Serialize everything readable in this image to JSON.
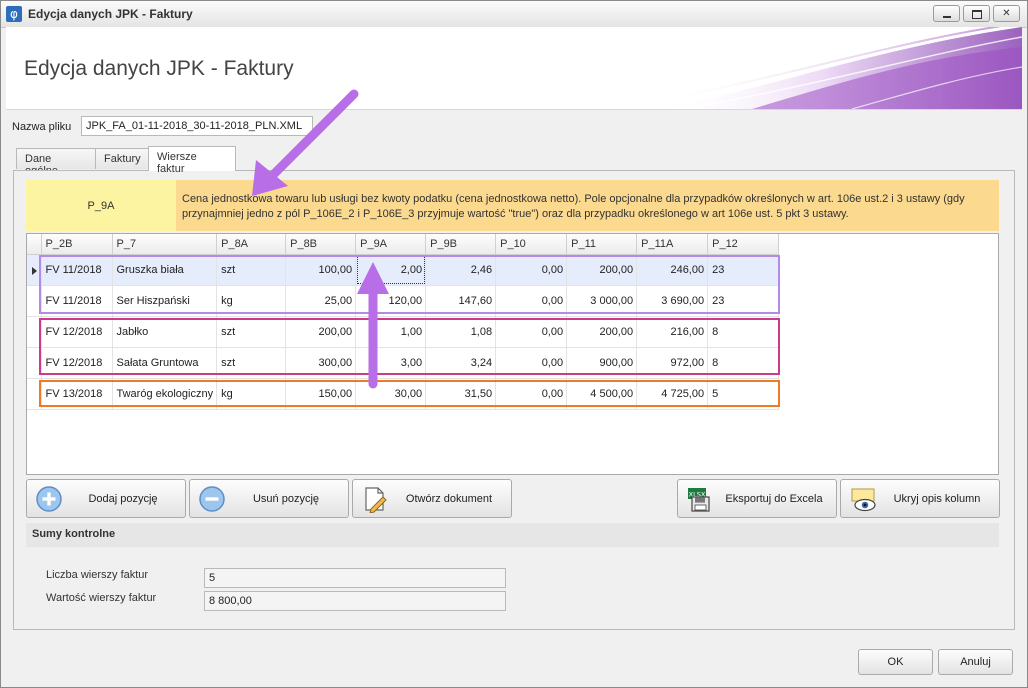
{
  "window": {
    "title": "Edycja danych JPK - Faktury"
  },
  "header": {
    "title": "Edycja danych JPK - Faktury"
  },
  "file": {
    "label": "Nazwa pliku",
    "value": "JPK_FA_01-11-2018_30-11-2018_PLN.XML"
  },
  "tabs": [
    "Dane ogólne",
    "Faktury",
    "Wiersze faktur"
  ],
  "description": {
    "key": "P_9A",
    "text": "Cena jednostkowa towaru lub usługi bez kwoty podatku (cena jednostkowa netto). Pole opcjonalne dla przypadków określonych w art. 106e ust.2 i 3 ustawy (gdy przynajmniej jedno z pól P_106E_2 i P_106E_3 przyjmuje wartość \"true\") oraz dla przypadku określonego w art 106e ust. 5 pkt 3 ustawy."
  },
  "grid": {
    "columns": [
      "P_2B",
      "P_7",
      "P_8A",
      "P_8B",
      "P_9A",
      "P_9B",
      "P_10",
      "P_11",
      "P_11A",
      "P_12"
    ],
    "rows": [
      [
        "FV 11/2018",
        "Gruszka biała",
        "szt",
        "100,00",
        "2,00",
        "2,46",
        "0,00",
        "200,00",
        "246,00",
        "23"
      ],
      [
        "FV 11/2018",
        "Ser Hiszpański",
        "kg",
        "25,00",
        "120,00",
        "147,60",
        "0,00",
        "3 000,00",
        "3 690,00",
        "23"
      ],
      [
        "FV 12/2018",
        "Jabłko",
        "szt",
        "200,00",
        "1,00",
        "1,08",
        "0,00",
        "200,00",
        "216,00",
        "8"
      ],
      [
        "FV 12/2018",
        "Sałata Gruntowa",
        "szt",
        "300,00",
        "3,00",
        "3,24",
        "0,00",
        "900,00",
        "972,00",
        "8"
      ],
      [
        "FV 13/2018",
        "Twaróg ekologiczny",
        "kg",
        "150,00",
        "30,00",
        "31,50",
        "0,00",
        "4 500,00",
        "4 725,00",
        "5"
      ]
    ]
  },
  "buttons": {
    "add": "Dodaj pozycję",
    "remove": "Usuń pozycję",
    "open": "Otwórz dokument",
    "export": "Eksportuj do Excela",
    "hide": "Ukryj opis kolumn"
  },
  "icons": {
    "add": "plus-circle-icon",
    "remove": "minus-circle-icon",
    "open": "document-pencil-icon",
    "export": "excel-save-icon",
    "hide": "eye-icon",
    "excel_badge": "XLSX"
  },
  "sums": {
    "title": "Sumy kontrolne",
    "count_label": "Liczba wierszy faktur",
    "count_value": "5",
    "total_label": "Wartość wierszy faktur",
    "total_value": "8 800,00"
  },
  "footer": {
    "ok": "OK",
    "cancel": "Anuluj"
  },
  "colors": {
    "desc_key_bg": "#fdf4a1",
    "desc_text_bg": "#fbd98f",
    "highlight_purple": "#b48ae8",
    "highlight_pink": "#cc3a8a",
    "highlight_orange": "#ec7a26",
    "annotation_arrow": "#b76ee6"
  }
}
